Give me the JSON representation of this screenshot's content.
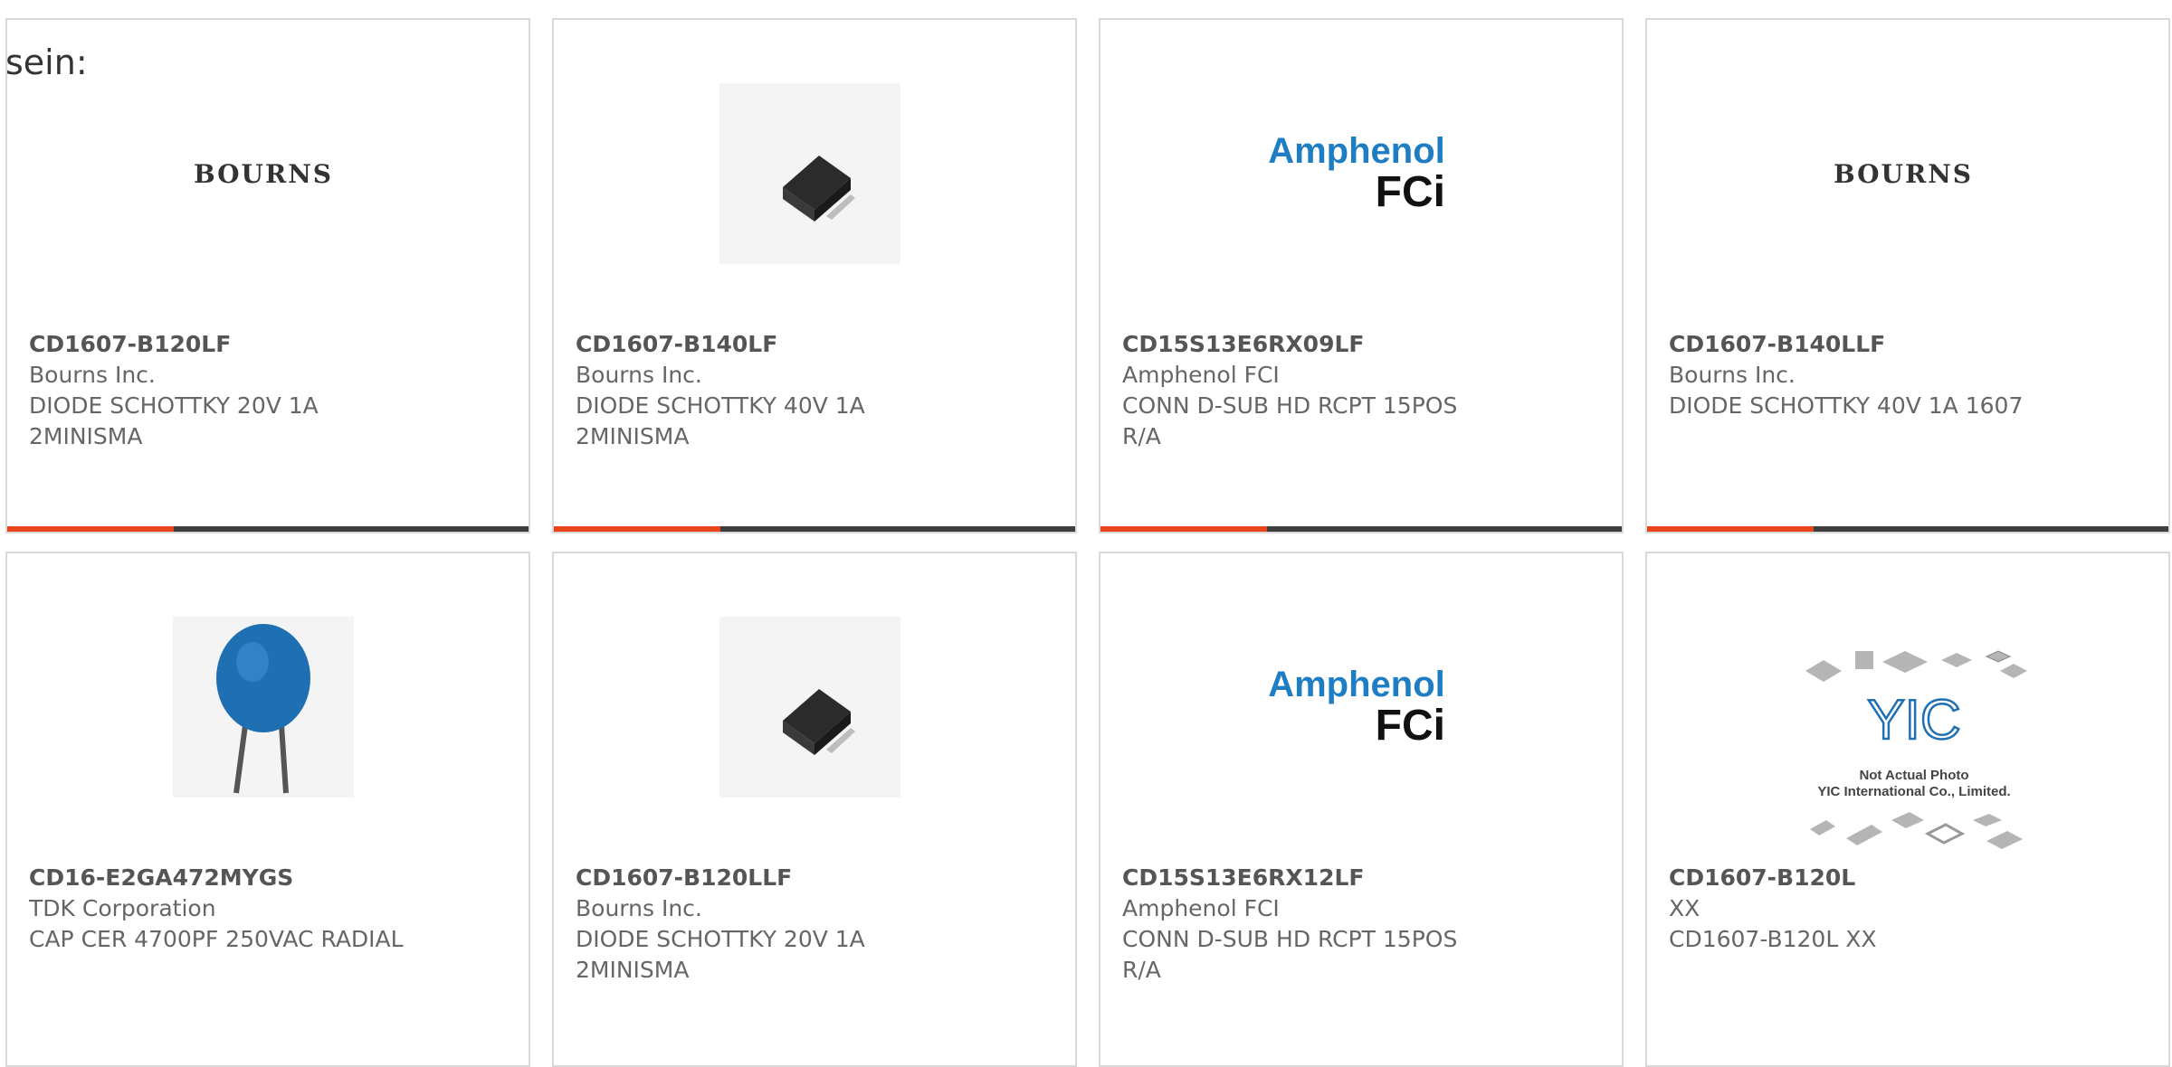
{
  "intro_text": "sein:",
  "theme": {
    "accent": "#e8451c",
    "bar": "#3e3e3e",
    "text": "#666666",
    "border": "#d9d9d9"
  },
  "products": [
    {
      "part": "CD1607-B120LF",
      "manufacturer": "Bourns Inc.",
      "description": "DIODE SCHOTTKY 20V 1A 2MINISMA",
      "image": "bourns-logo",
      "logo_text": "BOURNS"
    },
    {
      "part": "CD1607-B140LF",
      "manufacturer": "Bourns Inc.",
      "description": "DIODE SCHOTTKY 40V 1A 2MINISMA",
      "image": "smd-diode-photo"
    },
    {
      "part": "CD15S13E6RX09LF",
      "manufacturer": "Amphenol FCI",
      "description": "CONN D-SUB HD RCPT 15POS R/A",
      "image": "amphenol-fci-logo",
      "logo_line1": "Amphenol",
      "logo_line2": "FCi"
    },
    {
      "part": "CD1607-B140LLF",
      "manufacturer": "Bourns Inc.",
      "description": "DIODE SCHOTTKY 40V 1A 1607",
      "image": "bourns-logo",
      "logo_text": "BOURNS"
    },
    {
      "part": "CD16-E2GA472MYGS",
      "manufacturer": "TDK Corporation",
      "description": "CAP CER 4700PF 250VAC RADIAL",
      "image": "ceramic-capacitor-photo"
    },
    {
      "part": "CD1607-B120LLF",
      "manufacturer": "Bourns Inc.",
      "description": "DIODE SCHOTTKY 20V 1A 2MINISMA",
      "image": "smd-diode-photo"
    },
    {
      "part": "CD15S13E6RX12LF",
      "manufacturer": "Amphenol FCI",
      "description": "CONN D-SUB HD RCPT 15POS R/A",
      "image": "amphenol-fci-logo",
      "logo_line1": "Amphenol",
      "logo_line2": "FCi"
    },
    {
      "part": "CD1607-B120L",
      "manufacturer": "XX",
      "description": "CD1607-B120L XX",
      "image": "yic-placeholder",
      "placeholder_line1": "Not Actual Photo",
      "placeholder_line2": "YIC International Co., Limited."
    }
  ]
}
